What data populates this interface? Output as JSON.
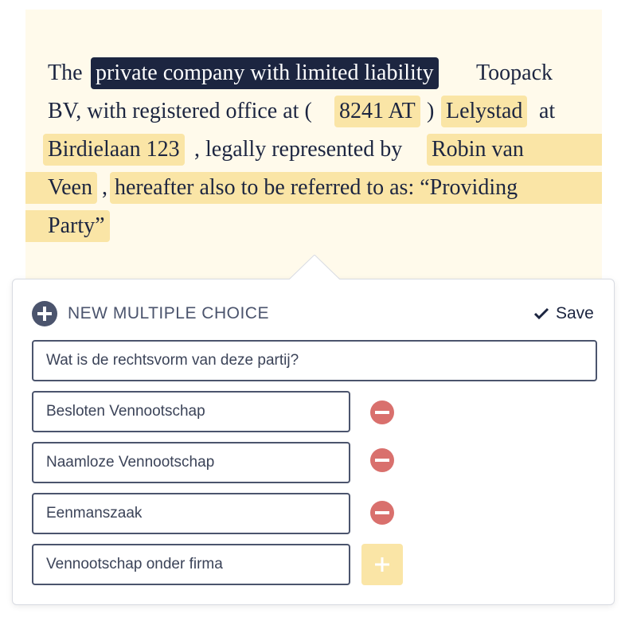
{
  "document": {
    "line1": {
      "text_the": "The",
      "highlight_legal_form": "private company with limited liability",
      "text_toopack": "Toopack"
    },
    "line2": {
      "text_bv": "BV, with registered office at (",
      "highlight_postcode": "8241 AT",
      "text_paren": ")",
      "highlight_city": "Lelystad",
      "text_at": "at"
    },
    "line3": {
      "highlight_address": "Birdielaan 123",
      "text_represented": ", legally represented by",
      "highlight_name_part1": "Robin van"
    },
    "line4": {
      "highlight_name_part2": "Veen",
      "text_comma": ",",
      "highlight_party_part1": "hereafter also to be referred to as: “Providing"
    },
    "line5": {
      "highlight_party_part2": "Party”"
    }
  },
  "editor": {
    "title": "NEW MULTIPLE CHOICE",
    "save_label": "Save",
    "question_value": "Wat is de rechtsvorm van deze partij?",
    "options": [
      "Besloten Vennootschap",
      "Naamloze Vennootschap",
      "Eenmanszaak"
    ],
    "new_option_value": "Vennootschap onder firma",
    "icons": {
      "header": "add-circle-icon",
      "save": "checkmark-icon",
      "remove": "remove-circle-icon",
      "add": "plus-icon"
    }
  },
  "colors": {
    "highlight": "#fae5a6",
    "highlight_selected": "#1c2540",
    "document_background": "#fffaeb",
    "remove_icon": "#d9706d",
    "text": "#1c2540"
  }
}
